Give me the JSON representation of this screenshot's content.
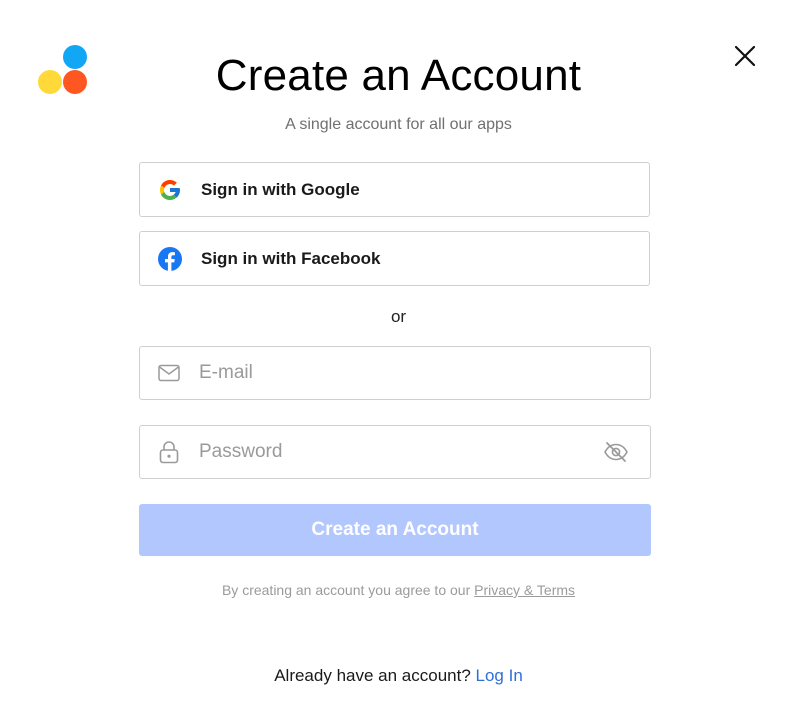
{
  "header": {
    "title": "Create an Account",
    "subtitle": "A single account for all our apps",
    "close_icon": "close-icon",
    "logo_colors": [
      "#11a7f5",
      "#ffd93a",
      "#ff5722"
    ]
  },
  "social": {
    "google_label": "Sign in with Google",
    "google_icon": "google-icon",
    "facebook_label": "Sign in with Facebook",
    "facebook_icon": "facebook-icon"
  },
  "divider_text": "or",
  "form": {
    "email_placeholder": "E-mail",
    "email_value": "",
    "email_icon": "mail-icon",
    "password_placeholder": "Password",
    "password_value": "",
    "password_icon": "lock-icon",
    "visibility_icon": "eye-off-icon",
    "submit_label": "Create an Account",
    "submit_color": "#b3c7ff"
  },
  "terms": {
    "text": "By creating an account you agree to our ",
    "link": "Privacy & Terms"
  },
  "footer": {
    "text": "Already have an account? ",
    "link": "Log In",
    "link_color": "#2f6fdc"
  }
}
